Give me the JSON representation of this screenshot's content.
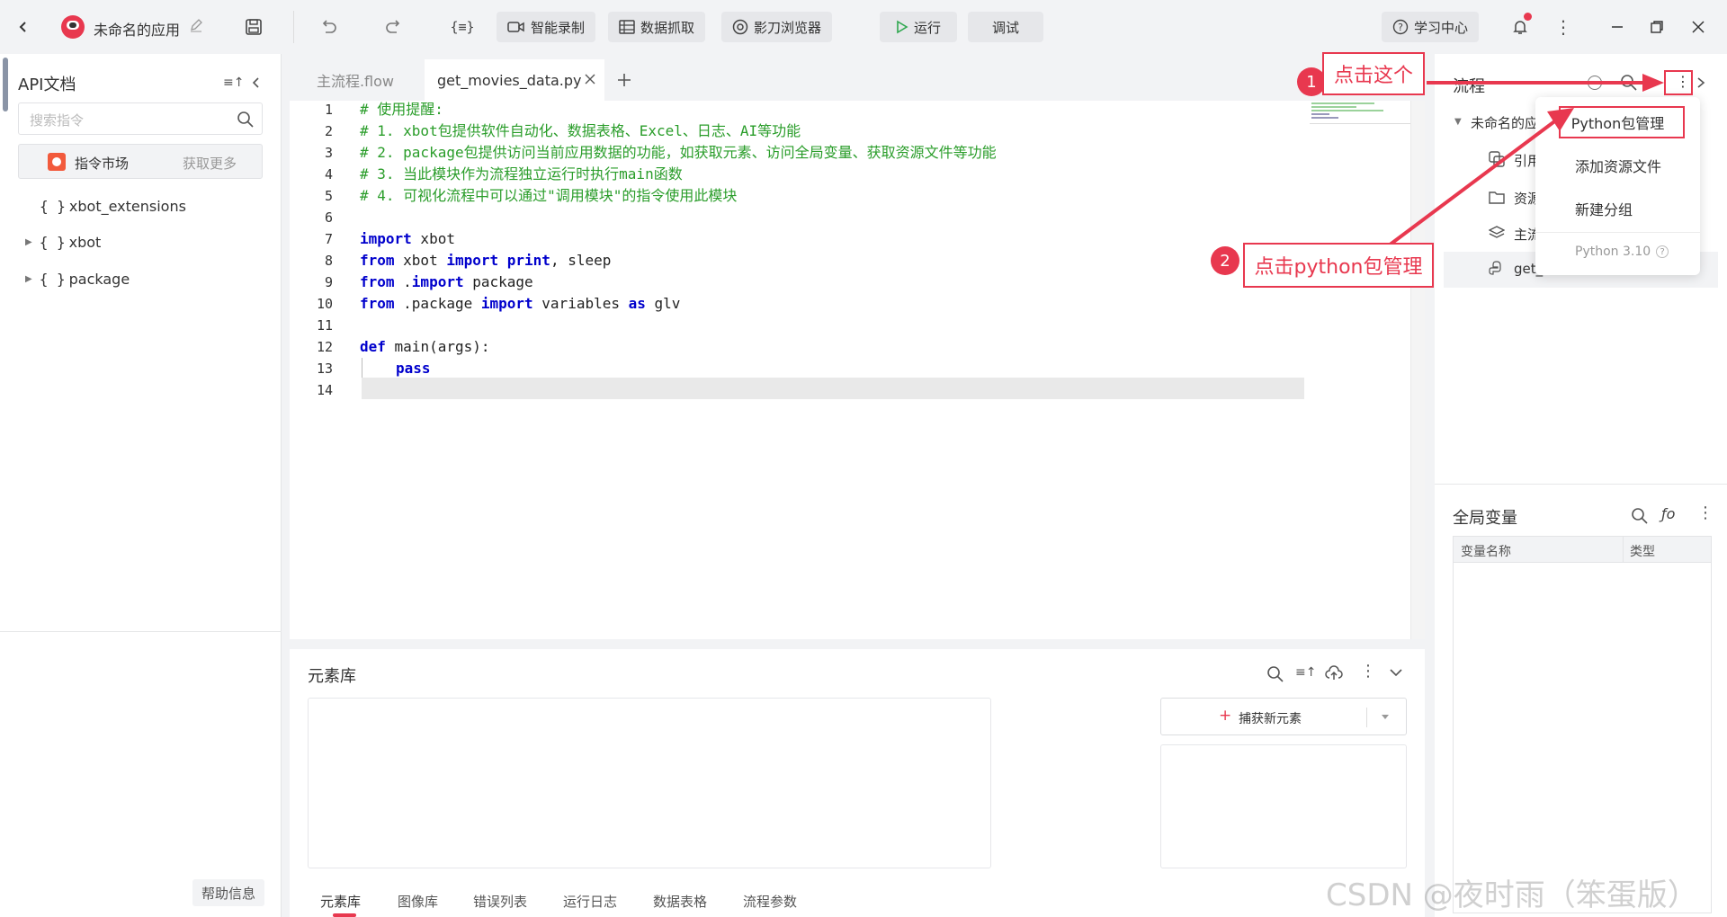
{
  "topbar": {
    "app_name": "未命名的应用",
    "smart_record": "智能录制",
    "data_scrape": "数据抓取",
    "browser": "影刀浏览器",
    "run": "运行",
    "debug": "调试",
    "learn_center": "学习中心"
  },
  "left": {
    "title": "API文档",
    "search_placeholder": "搜索指令",
    "market_label": "指令市场",
    "get_more": "获取更多",
    "tree": [
      {
        "label": "xbot_extensions"
      },
      {
        "label": "xbot"
      },
      {
        "label": "package"
      }
    ],
    "help": "帮助信息"
  },
  "editor": {
    "tabs": [
      {
        "label": "主流程.flow"
      },
      {
        "label": "get_movies_data.py"
      }
    ],
    "line_numbers": [
      "1",
      "2",
      "3",
      "4",
      "5",
      "6",
      "7",
      "8",
      "9",
      "10",
      "11",
      "12",
      "13",
      "14"
    ],
    "comment_lines": [
      "# 使用提醒:",
      "# 1. xbot包提供软件自动化、数据表格、Excel、日志、AI等功能",
      "# 2. package包提供访问当前应用数据的功能，如获取元素、访问全局变量、获取资源文件等功能",
      "# 3. 当此模块作为流程独立运行时执行main函数",
      "# 4. 可视化流程中可以通过\"调用模块\"的指令使用此模块"
    ],
    "kw_import": "import",
    "kw_from": "from",
    "kw_as": "as",
    "kw_def": "def",
    "kw_pass": "pass",
    "kw_print": "print",
    "code": {
      "l7_rest": " xbot",
      "l8_mod": " xbot ",
      "l8_rest": ", sleep",
      "l9_mod": " .",
      "l9_rest": " package",
      "l10_mod": " .package ",
      "l10_mid": " variables ",
      "l10_rest": " glv",
      "l12_rest": " main(args):"
    }
  },
  "element_library": {
    "title": "元素库",
    "capture_button": "捕获新元素",
    "bottom_tabs": [
      "元素库",
      "图像库",
      "错误列表",
      "运行日志",
      "数据表格",
      "流程参数"
    ]
  },
  "right": {
    "flow_title": "流程",
    "tree_root": "未命名的应",
    "items": [
      {
        "label": "引用"
      },
      {
        "label": "资源"
      },
      {
        "label": "主流"
      },
      {
        "label": "get_"
      }
    ],
    "global_vars_title": "全局变量",
    "col_name": "变量名称",
    "col_type": "类型"
  },
  "dropdown": {
    "items": [
      "Python包管理",
      "添加资源文件",
      "新建分组"
    ],
    "version": "Python 3.10"
  },
  "annotations": {
    "note1_num": "1",
    "note1_text": "点击这个",
    "note2_num": "2",
    "note2_text": "点击python包管理",
    "accent": "#e8384f"
  },
  "watermark": "CSDN @夜时雨（笨蛋版）"
}
